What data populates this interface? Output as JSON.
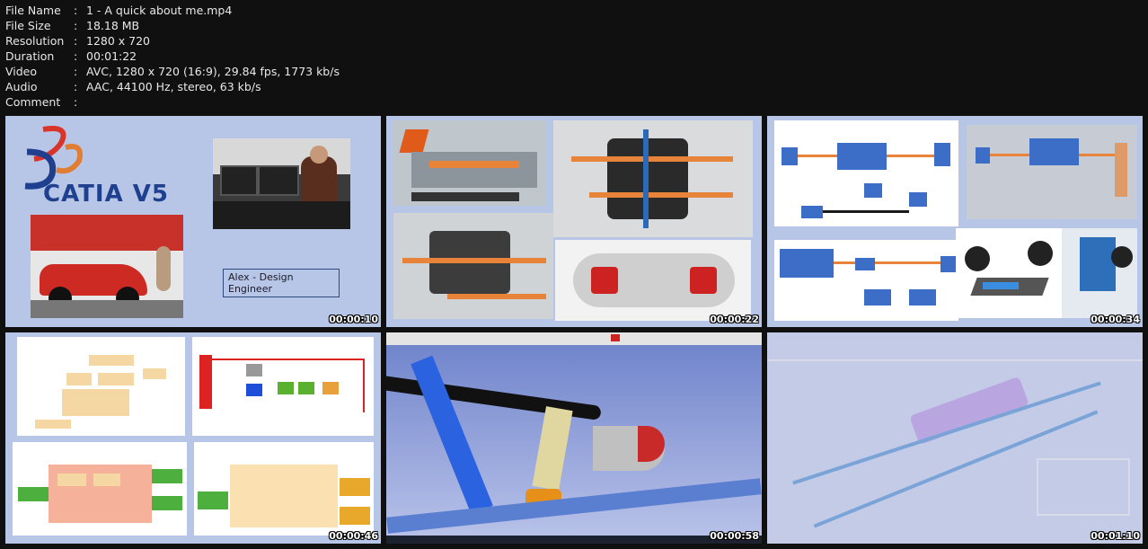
{
  "file_info": [
    {
      "key": "File Name",
      "value": "1 - A quick about me.mp4"
    },
    {
      "key": "File Size",
      "value": "18.18 MB"
    },
    {
      "key": "Resolution",
      "value": "1280 x 720"
    },
    {
      "key": "Duration",
      "value": "00:01:22"
    },
    {
      "key": "Video",
      "value": "AVC, 1280 x 720 (16:9), 29.84 fps, 1773 kb/s"
    },
    {
      "key": "Audio",
      "value": "AAC, 44100 Hz, stereo, 63 kb/s"
    },
    {
      "key": "Comment",
      "value": ""
    }
  ],
  "separator": ":",
  "thumbnails": [
    {
      "timestamp": "00:00:10",
      "logo_text": "CATIA V5",
      "caption": "Alex - Design Engineer"
    },
    {
      "timestamp": "00:00:22"
    },
    {
      "timestamp": "00:00:34"
    },
    {
      "timestamp": "00:00:46"
    },
    {
      "timestamp": "00:00:58"
    },
    {
      "timestamp": "00:01:10"
    }
  ],
  "colors": {
    "background": "#101010",
    "slide_blue": "#b7c6e6",
    "orange": "#e8843a",
    "catia_blue": "#1f3f8f",
    "catia_red": "#d8342a"
  }
}
